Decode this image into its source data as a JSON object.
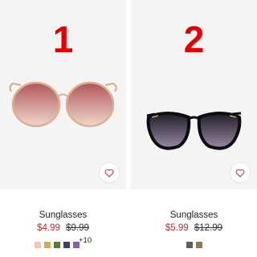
{
  "products": [
    {
      "rank": "1",
      "name": "Sunglasses",
      "price": "$4.99",
      "original_price": "$9.99",
      "more_colors": "+10",
      "swatches": [
        "#f0c6b4",
        "#c8b25c",
        "#5c7a3a",
        "#3e3e6e",
        "#8a5fb0"
      ]
    },
    {
      "rank": "2",
      "name": "Sunglasses",
      "price": "$5.99",
      "original_price": "$12.99",
      "swatches": [
        "#5e5e5e",
        "#8a7a5c"
      ]
    }
  ],
  "icons": {
    "favorite": "heart-outline-icon"
  },
  "colors": {
    "rank": "#e60000",
    "sale_price": "#d8202a",
    "heart": "#d0324a"
  }
}
